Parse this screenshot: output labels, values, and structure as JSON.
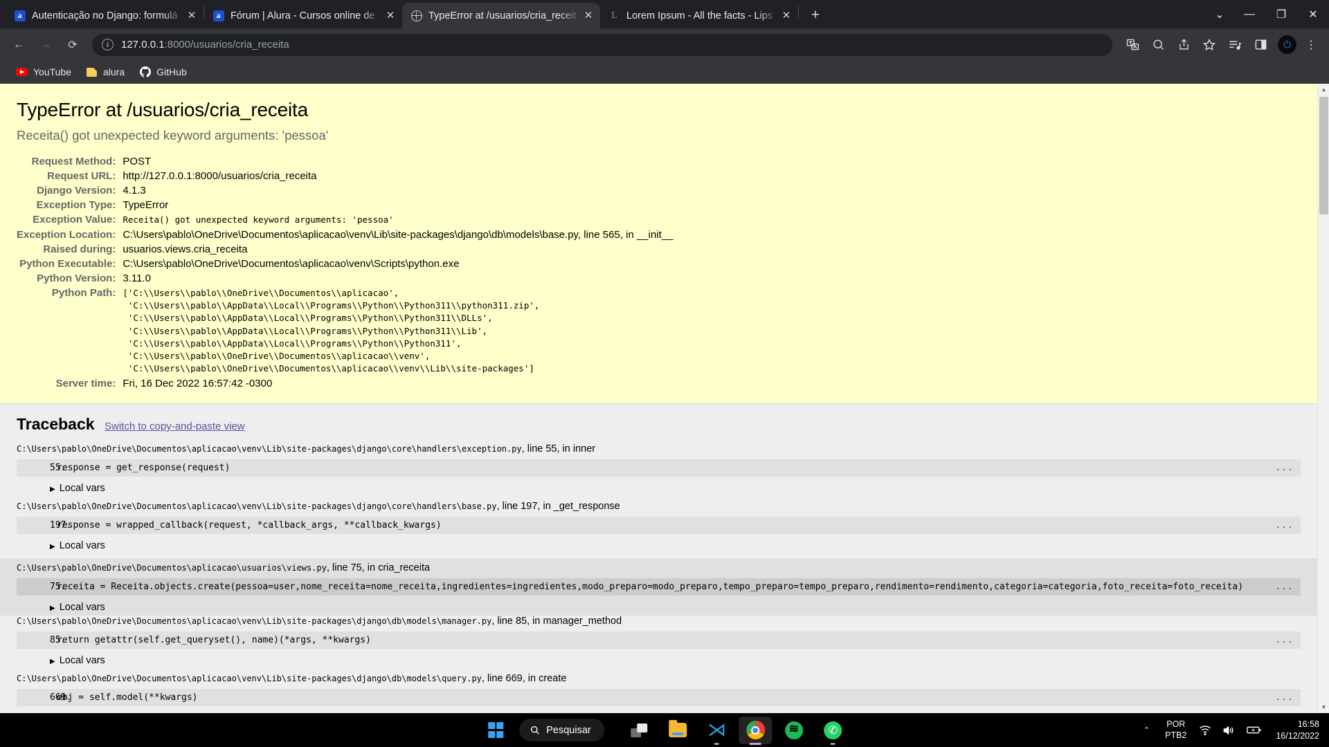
{
  "browser": {
    "tabs": [
      {
        "title": "Autenticação no Django: formulá",
        "favicon": "alura-icon",
        "active": false
      },
      {
        "title": "Fórum | Alura - Cursos online de",
        "favicon": "alura-icon",
        "active": false
      },
      {
        "title": "TypeError at /usuarios/cria_receit",
        "favicon": "globe-icon",
        "active": true
      },
      {
        "title": "Lorem Ipsum - All the facts - Lips",
        "favicon": "lipsum-icon",
        "active": false
      }
    ],
    "new_tab_label": "+",
    "window_controls": {
      "tab_search": "⌄",
      "minimize": "—",
      "maximize": "❐",
      "close": "✕"
    },
    "toolbar": {
      "back": "←",
      "forward": "→",
      "reload": "⟳",
      "url_host": "127.0.0.1",
      "url_rest": ":8000/usuarios/cria_receita",
      "url_full": "127.0.0.1:8000/usuarios/cria_receita",
      "site_info": "ⓘ",
      "icons": [
        "translate-icon",
        "search-icon",
        "share-icon",
        "bookmark-star-icon",
        "reading-list-icon",
        "side-panel-icon"
      ],
      "profile_initial": "⏻",
      "menu": "⋮"
    },
    "bookmarks": [
      {
        "label": "YouTube",
        "icon": "youtube-icon"
      },
      {
        "label": "alura",
        "icon": "folder-icon"
      },
      {
        "label": "GitHub",
        "icon": "github-icon"
      }
    ]
  },
  "django": {
    "title": "TypeError at /usuarios/cria_receita",
    "subtitle": "Receita() got unexpected keyword arguments: 'pessoa'",
    "meta": [
      {
        "label": "Request Method:",
        "value": "POST",
        "mono": false
      },
      {
        "label": "Request URL:",
        "value": "http://127.0.0.1:8000/usuarios/cria_receita",
        "mono": false
      },
      {
        "label": "Django Version:",
        "value": "4.1.3",
        "mono": false
      },
      {
        "label": "Exception Type:",
        "value": "TypeError",
        "mono": false
      },
      {
        "label": "Exception Value:",
        "value": "Receita() got unexpected keyword arguments: 'pessoa'",
        "mono": true
      },
      {
        "label": "Exception Location:",
        "value": "C:\\Users\\pablo\\OneDrive\\Documentos\\aplicacao\\venv\\Lib\\site-packages\\django\\db\\models\\base.py, line 565, in __init__",
        "mono": false
      },
      {
        "label": "Raised during:",
        "value": "usuarios.views.cria_receita",
        "mono": false
      },
      {
        "label": "Python Executable:",
        "value": "C:\\Users\\pablo\\OneDrive\\Documentos\\aplicacao\\venv\\Scripts\\python.exe",
        "mono": false
      },
      {
        "label": "Python Version:",
        "value": "3.11.0",
        "mono": false
      }
    ],
    "python_path_label": "Python Path:",
    "python_path": "['C:\\\\Users\\\\pablo\\\\OneDrive\\\\Documentos\\\\aplicacao',\n 'C:\\\\Users\\\\pablo\\\\AppData\\\\Local\\\\Programs\\\\Python\\\\Python311\\\\python311.zip',\n 'C:\\\\Users\\\\pablo\\\\AppData\\\\Local\\\\Programs\\\\Python\\\\Python311\\\\DLLs',\n 'C:\\\\Users\\\\pablo\\\\AppData\\\\Local\\\\Programs\\\\Python\\\\Python311\\\\Lib',\n 'C:\\\\Users\\\\pablo\\\\AppData\\\\Local\\\\Programs\\\\Python\\\\Python311',\n 'C:\\\\Users\\\\pablo\\\\OneDrive\\\\Documentos\\\\aplicacao\\\\venv',\n 'C:\\\\Users\\\\pablo\\\\OneDrive\\\\Documentos\\\\aplicacao\\\\venv\\\\Lib\\\\site-packages']",
    "server_time_label": "Server time:",
    "server_time": "Fri, 16 Dec 2022 16:57:42 -0300",
    "traceback_heading": "Traceback",
    "switch_link": "Switch to copy-and-paste view",
    "local_vars_label": "Local vars",
    "frames": [
      {
        "path": "C:\\Users\\pablo\\OneDrive\\Documentos\\aplicacao\\venv\\Lib\\site-packages\\django\\core\\handlers\\exception.py",
        "tail": ", line 55, in inner",
        "lineno": "55.",
        "code": "response = get_response(request)",
        "highlight": false,
        "has_local_vars": true
      },
      {
        "path": "C:\\Users\\pablo\\OneDrive\\Documentos\\aplicacao\\venv\\Lib\\site-packages\\django\\core\\handlers\\base.py",
        "tail": ", line 197, in _get_response",
        "lineno": "197.",
        "code": "response = wrapped_callback(request, *callback_args, **callback_kwargs)",
        "highlight": false,
        "has_local_vars": true
      },
      {
        "path": "C:\\Users\\pablo\\OneDrive\\Documentos\\aplicacao\\usuarios\\views.py",
        "tail": ", line 75, in cria_receita",
        "lineno": "75.",
        "code": "receita = Receita.objects.create(pessoa=user,nome_receita=nome_receita,ingredientes=ingredientes,modo_preparo=modo_preparo,tempo_preparo=tempo_preparo,rendimento=rendimento,categoria=categoria,foto_receita=foto_receita)",
        "highlight": true,
        "has_local_vars": true
      },
      {
        "path": "C:\\Users\\pablo\\OneDrive\\Documentos\\aplicacao\\venv\\Lib\\site-packages\\django\\db\\models\\manager.py",
        "tail": ", line 85, in manager_method",
        "lineno": "85.",
        "code": "return getattr(self.get_queryset(), name)(*args, **kwargs)",
        "highlight": false,
        "has_local_vars": true
      },
      {
        "path": "C:\\Users\\pablo\\OneDrive\\Documentos\\aplicacao\\venv\\Lib\\site-packages\\django\\db\\models\\query.py",
        "tail": ", line 669, in create",
        "lineno": "669.",
        "code": "obj = self.model(**kwargs)",
        "highlight": false,
        "has_local_vars": false
      }
    ]
  },
  "taskbar": {
    "start_label": "start-button",
    "search_placeholder": "Pesquisar",
    "items": [
      {
        "name": "task-view",
        "icon": "task-view-icon",
        "active": false,
        "running": false
      },
      {
        "name": "file-explorer",
        "icon": "file-explorer-icon",
        "active": false,
        "running": false
      },
      {
        "name": "vs-code",
        "icon": "vscode-icon",
        "active": false,
        "running": true
      },
      {
        "name": "google-chrome",
        "icon": "chrome-icon",
        "active": true,
        "running": true
      },
      {
        "name": "spotify",
        "icon": "spotify-icon",
        "active": false,
        "running": false
      },
      {
        "name": "whatsapp",
        "icon": "whatsapp-icon",
        "active": false,
        "running": true
      }
    ],
    "tray": {
      "chevron": "⌃",
      "lang_line1": "POR",
      "lang_line2": "PTB2",
      "wifi": "wifi-icon",
      "volume": "volume-icon",
      "battery": "battery-charging-icon",
      "time": "16:58",
      "date": "16/12/2022"
    }
  },
  "colors": {
    "chrome_frame": "#202124",
    "chrome_toolbar": "#35363a",
    "django_summary_bg": "#ffc",
    "django_traceback_bg": "#eee",
    "link": "#5a4fa3"
  }
}
